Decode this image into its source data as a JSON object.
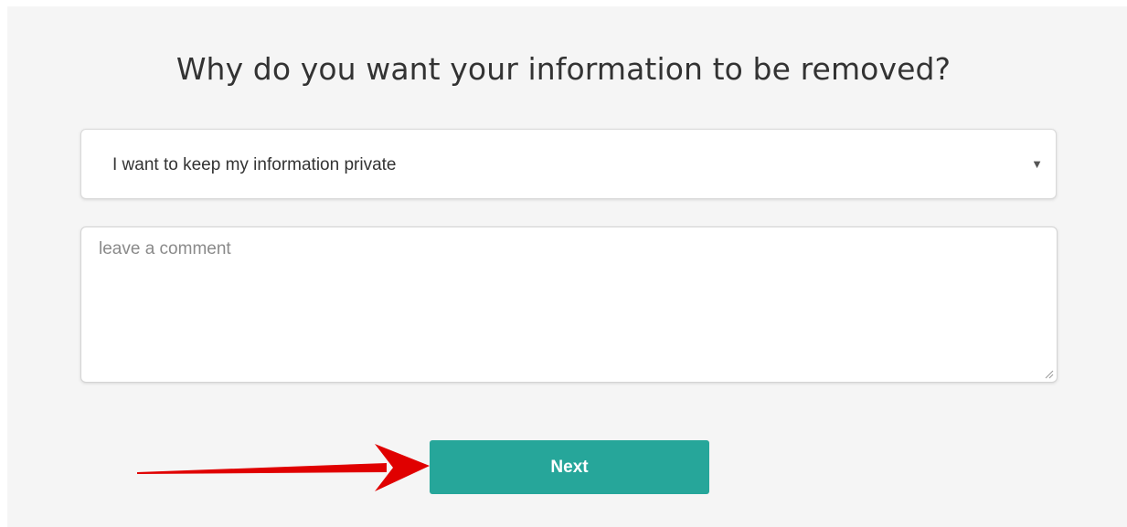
{
  "page": {
    "heading": "Why do you want your information to be removed?"
  },
  "reason_select": {
    "selected_value": "I want to keep my information private",
    "caret_icon": "caret-down-icon"
  },
  "comment_field": {
    "placeholder": "leave a comment",
    "value": ""
  },
  "next_button": {
    "label": "Next"
  },
  "colors": {
    "panel_bg": "#f5f5f5",
    "button_bg": "#26a69a",
    "arrow": "#e00000",
    "heading_text": "#333333"
  }
}
